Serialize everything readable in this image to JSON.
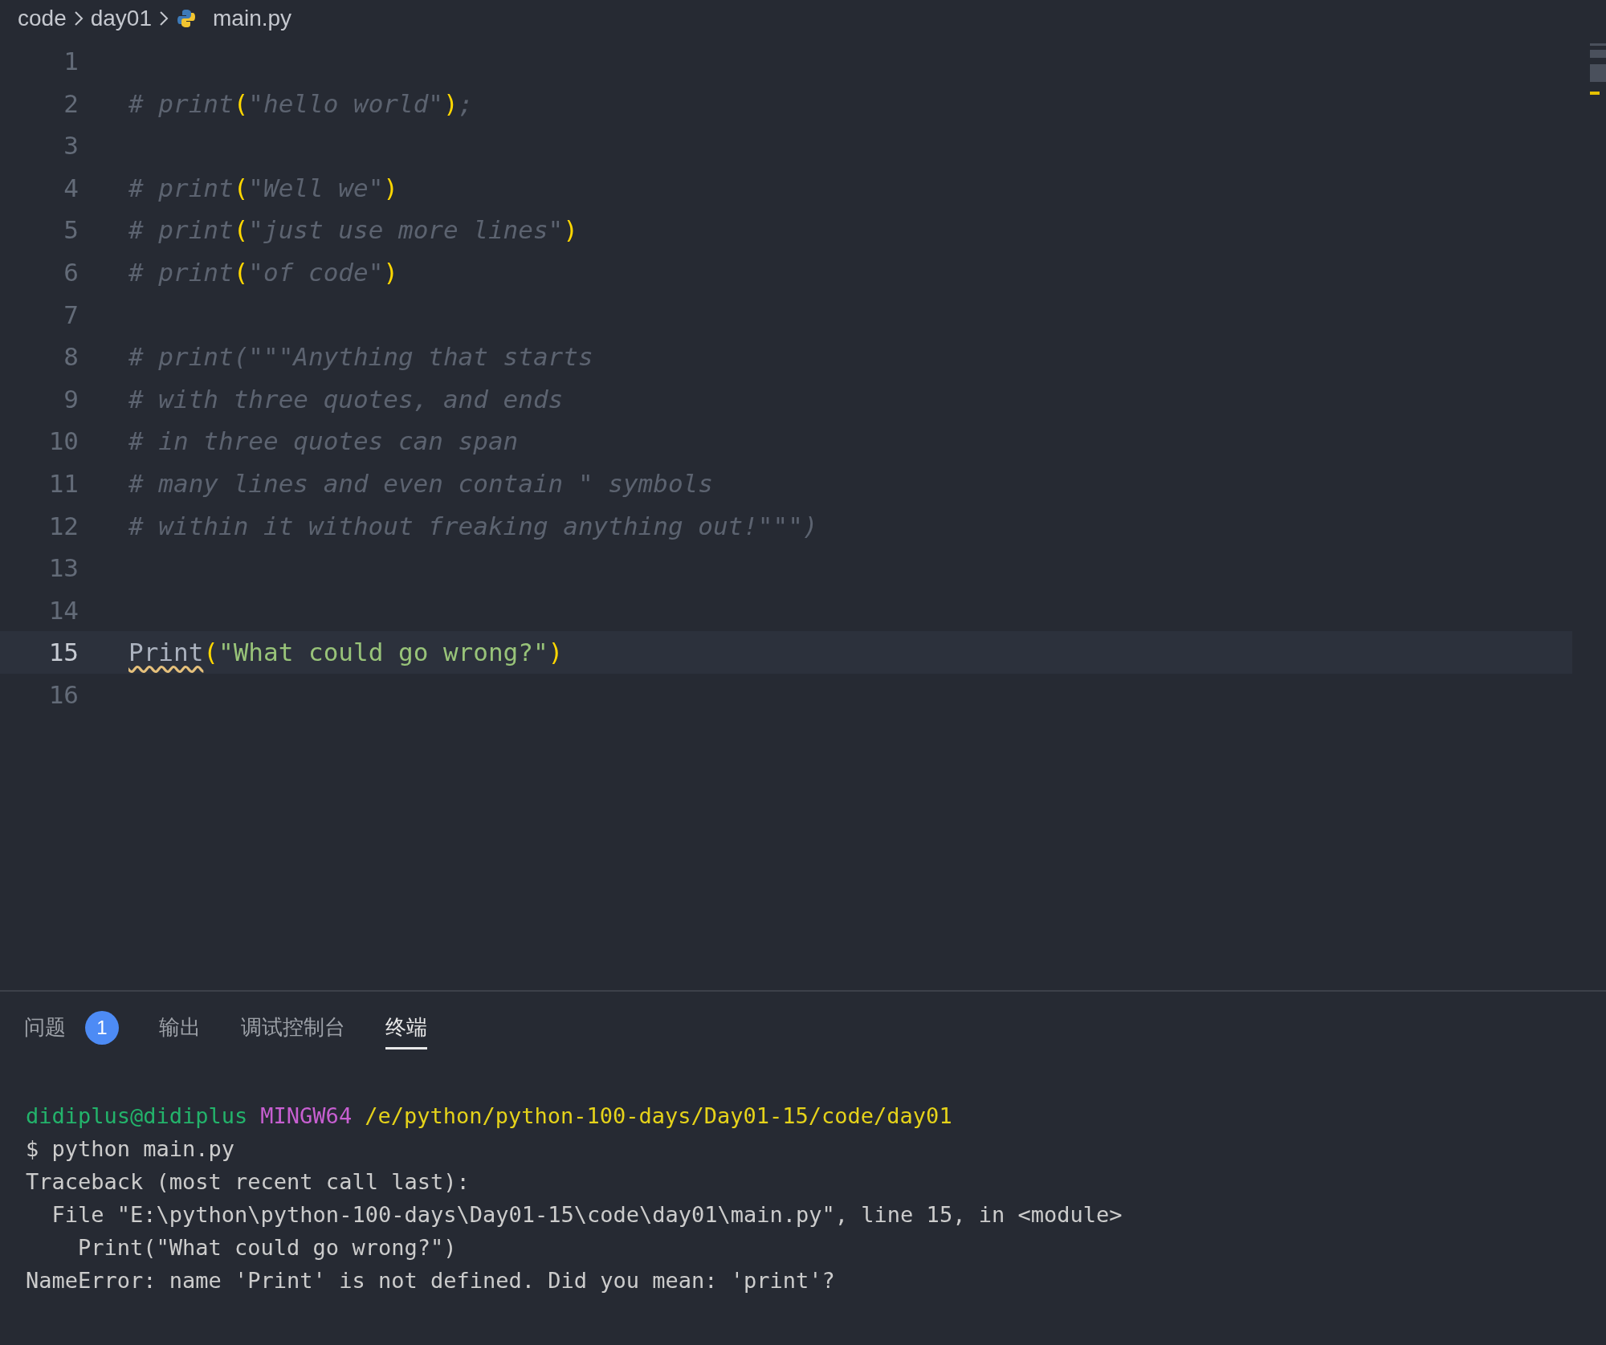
{
  "breadcrumb": [
    "code",
    "day01",
    "main.py"
  ],
  "editor": {
    "lines": [
      {
        "number": "1",
        "active": false
      },
      {
        "number": "2",
        "active": false,
        "tokens": [
          {
            "kind": "comment",
            "text": "# print"
          },
          {
            "kind": "paren",
            "text": "("
          },
          {
            "kind": "comment",
            "text": "\"hello world\""
          },
          {
            "kind": "paren",
            "text": ")"
          },
          {
            "kind": "comment",
            "text": ";"
          }
        ]
      },
      {
        "number": "3",
        "active": false
      },
      {
        "number": "4",
        "active": false,
        "tokens": [
          {
            "kind": "comment",
            "text": "# print"
          },
          {
            "kind": "paren",
            "text": "("
          },
          {
            "kind": "comment",
            "text": "\"Well we\""
          },
          {
            "kind": "paren",
            "text": ")"
          }
        ]
      },
      {
        "number": "5",
        "active": false,
        "tokens": [
          {
            "kind": "comment",
            "text": "# print"
          },
          {
            "kind": "paren",
            "text": "("
          },
          {
            "kind": "comment",
            "text": "\"just use more lines\""
          },
          {
            "kind": "paren",
            "text": ")"
          }
        ]
      },
      {
        "number": "6",
        "active": false,
        "tokens": [
          {
            "kind": "comment",
            "text": "# print"
          },
          {
            "kind": "paren",
            "text": "("
          },
          {
            "kind": "comment",
            "text": "\"of code\""
          },
          {
            "kind": "paren",
            "text": ")"
          }
        ]
      },
      {
        "number": "7",
        "active": false
      },
      {
        "number": "8",
        "active": false,
        "tokens": [
          {
            "kind": "comment",
            "text": "# print(\"\"\"Anything that starts"
          }
        ]
      },
      {
        "number": "9",
        "active": false,
        "tokens": [
          {
            "kind": "comment",
            "text": "# with three quotes, and ends"
          }
        ]
      },
      {
        "number": "10",
        "active": false,
        "tokens": [
          {
            "kind": "comment",
            "text": "# in three quotes can span"
          }
        ]
      },
      {
        "number": "11",
        "active": false,
        "tokens": [
          {
            "kind": "comment",
            "text": "# many lines and even contain \" symbols"
          }
        ]
      },
      {
        "number": "12",
        "active": false,
        "tokens": [
          {
            "kind": "comment",
            "text": "# within it without freaking anything out!\"\"\")"
          }
        ]
      },
      {
        "number": "13",
        "active": false
      },
      {
        "number": "14",
        "active": false
      },
      {
        "number": "15",
        "active": true,
        "tokens": [
          {
            "kind": "undefined_name",
            "text": "Print"
          },
          {
            "kind": "paren",
            "text": "("
          },
          {
            "kind": "string",
            "text": "\"What could go wrong?\""
          },
          {
            "kind": "paren",
            "text": ")"
          }
        ]
      },
      {
        "number": "16",
        "active": false
      }
    ]
  },
  "panel": {
    "tabs": [
      {
        "label": "问题",
        "badge": "1",
        "selected": false
      },
      {
        "label": "输出",
        "selected": false
      },
      {
        "label": "调试控制台",
        "selected": false
      },
      {
        "label": "终端",
        "selected": true
      }
    ],
    "terminal": [
      {
        "segments": [
          {
            "kind": "user",
            "text": "didiplus@didiplus"
          },
          {
            "kind": "system",
            "text": "MINGW64"
          },
          {
            "kind": "path",
            "text": "/e/python/python-100-days/Day01-15/code/day01"
          }
        ]
      },
      {
        "segments": [
          {
            "kind": "plain",
            "text": "$ python main.py"
          }
        ]
      },
      {
        "segments": [
          {
            "kind": "plain",
            "text": "Traceback (most recent call last):"
          }
        ]
      },
      {
        "segments": [
          {
            "kind": "plain",
            "text": "  File \"E:\\python\\python-100-days\\Day01-15\\code\\day01\\main.py\", line 15, in <module>"
          }
        ]
      },
      {
        "segments": [
          {
            "kind": "plain",
            "text": "    Print(\"What could go wrong?\")"
          }
        ]
      },
      {
        "segments": [
          {
            "kind": "plain",
            "text": "NameError: name 'Print' is not defined. Did you mean: 'print'?"
          }
        ]
      }
    ]
  }
}
